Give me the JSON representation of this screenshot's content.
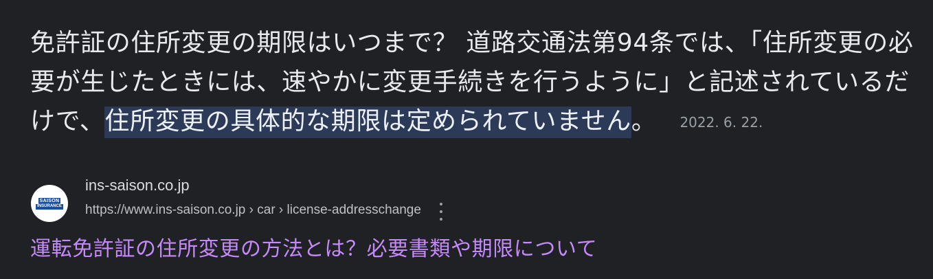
{
  "snippet": {
    "text_before": "免許証の住所変更の期限はいつまで？ 道路交通法第94条では、「住所変更の必要が生じたときには、速やかに変更手続きを行うように」と記述されているだけで、",
    "highlight": "住所変更の具体的な期限は定められていません",
    "text_after": "。",
    "date": "2022. 6. 22."
  },
  "result": {
    "favicon": {
      "icon": "saison-insurance-logo",
      "logo_line1": "SAISON",
      "logo_line2": "INSURANCE"
    },
    "site_name": "ins-saison.co.jp",
    "url": "https://www.ins-saison.co.jp › car › license-addresschange",
    "more_icon": "vertical-dots-icon",
    "title": "運転免許証の住所変更の方法とは？必要書類や期限について"
  },
  "colors": {
    "background": "#202124",
    "snippet_text": "#e8eaed",
    "highlight_bg": "#2c3a58",
    "link_visited": "#c58af9",
    "secondary_text": "#9aa0a6"
  }
}
